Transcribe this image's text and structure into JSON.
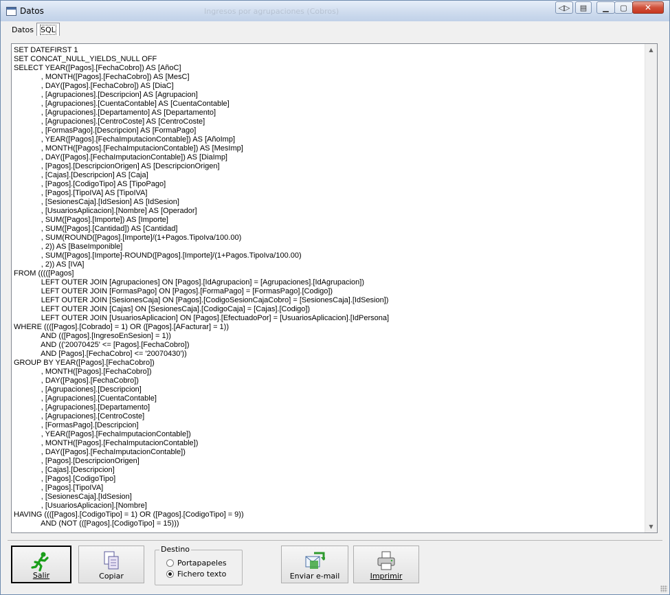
{
  "window": {
    "title": "Datos",
    "ghost_title": "Ingresos por agrupaciones (Cobros)",
    "controls": {
      "extra1": "◁▷",
      "extra2": "▤",
      "minimize": "▁",
      "maximize": "▢",
      "close": "✕"
    }
  },
  "tabs": [
    {
      "label": "Datos"
    },
    {
      "label": "SQL"
    }
  ],
  "sql": "SET DATEFIRST 1\nSET CONCAT_NULL_YIELDS_NULL OFF\nSELECT YEAR([Pagos].[FechaCobro]) AS [AñoC]\n             , MONTH([Pagos].[FechaCobro]) AS [MesC]\n             , DAY([Pagos].[FechaCobro]) AS [DiaC]\n             , [Agrupaciones].[Descripcion] AS [Agrupacion]\n             , [Agrupaciones].[CuentaContable] AS [CuentaContable]\n             , [Agrupaciones].[Departamento] AS [Departamento]\n             , [Agrupaciones].[CentroCoste] AS [CentroCoste]\n             , [FormasPago].[Descripcion] AS [FormaPago]\n             , YEAR([Pagos].[FechaImputacionContable]) AS [AñoImp]\n             , MONTH([Pagos].[FechaImputacionContable]) AS [MesImp]\n             , DAY([Pagos].[FechaImputacionContable]) AS [DiaImp]\n             , [Pagos].[DescripcionOrigen] AS [DescripcionOrigen]\n             , [Cajas].[Descripcion] AS [Caja]\n             , [Pagos].[CodigoTipo] AS [TipoPago]\n             , [Pagos].[TipoIVA] AS [TipoIVA]\n             , [SesionesCaja].[IdSesion] AS [IdSesion]\n             , [UsuariosAplicacion].[Nombre] AS [Operador]\n             , SUM([Pagos].[Importe]) AS [Importe]\n             , SUM([Pagos].[Cantidad]) AS [Cantidad]\n             , SUM(ROUND([Pagos].[Importe]/(1+Pagos.TipoIva/100.00)\n             , 2)) AS [BaseImponible]\n             , SUM([Pagos].[Importe]-ROUND([Pagos].[Importe]/(1+Pagos.TipoIva/100.00)\n             , 2)) AS [IVA]\nFROM (((([Pagos]\n             LEFT OUTER JOIN [Agrupaciones] ON [Pagos].[IdAgrupacion] = [Agrupaciones].[IdAgrupacion])\n             LEFT OUTER JOIN [FormasPago] ON [Pagos].[FormaPago] = [FormasPago].[Codigo])\n             LEFT OUTER JOIN [SesionesCaja] ON [Pagos].[CodigoSesionCajaCobro] = [SesionesCaja].[IdSesion])\n             LEFT OUTER JOIN [Cajas] ON [SesionesCaja].[CodigoCaja] = [Cajas].[Codigo])\n             LEFT OUTER JOIN [UsuariosAplicacion] ON [Pagos].[EfectuadoPor] = [UsuariosAplicacion].[IdPersona]\nWHERE ((([Pagos].[Cobrado] = 1) OR ([Pagos].[AFacturar] = 1))\n             AND (([Pagos].[IngresoEnSesion] = 1))\n             AND (('20070425' <= [Pagos].[FechaCobro])\n             AND [Pagos].[FechaCobro] <= '20070430'))\nGROUP BY YEAR([Pagos].[FechaCobro])\n             , MONTH([Pagos].[FechaCobro])\n             , DAY([Pagos].[FechaCobro])\n             , [Agrupaciones].[Descripcion]\n             , [Agrupaciones].[CuentaContable]\n             , [Agrupaciones].[Departamento]\n             , [Agrupaciones].[CentroCoste]\n             , [FormasPago].[Descripcion]\n             , YEAR([Pagos].[FechaImputacionContable])\n             , MONTH([Pagos].[FechaImputacionContable])\n             , DAY([Pagos].[FechaImputacionContable])\n             , [Pagos].[DescripcionOrigen]\n             , [Cajas].[Descripcion]\n             , [Pagos].[CodigoTipo]\n             , [Pagos].[TipoIVA]\n             , [SesionesCaja].[IdSesion]\n             , [UsuariosAplicacion].[Nombre]\nHAVING ((([Pagos].[CodigoTipo] = 1) OR ([Pagos].[CodigoTipo] = 9))\n             AND (NOT (([Pagos].[CodigoTipo] = 15)))",
  "buttons": {
    "salir": "Salir",
    "copiar": "Copiar",
    "enviar": "Enviar e-mail",
    "imprimir": "Imprimir"
  },
  "destino": {
    "legend": "Destino",
    "options": [
      {
        "label": "Portapapeles",
        "checked": false
      },
      {
        "label": "Fichero texto",
        "checked": true
      }
    ]
  },
  "icons": {
    "salir": "running-man-icon",
    "copiar": "copy-documents-icon",
    "enviar": "send-email-icon",
    "imprimir": "printer-icon"
  },
  "colors": {
    "salir_icon": "#1a9e1a",
    "title_bg": "#cfdcee",
    "close_btn": "#c7361f"
  }
}
